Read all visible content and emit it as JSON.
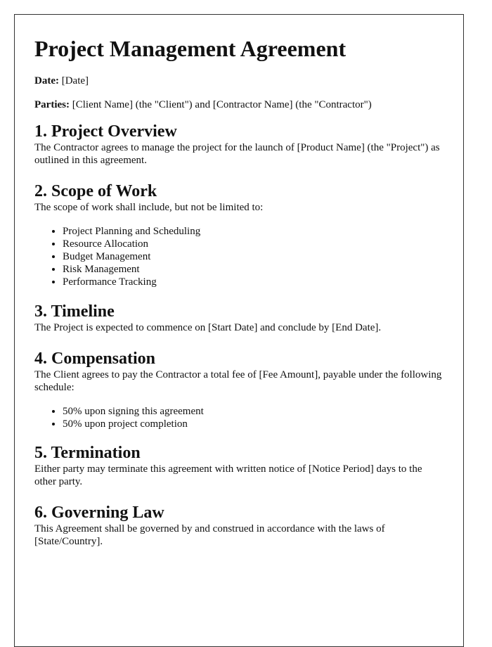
{
  "document": {
    "title": "Project Management Agreement",
    "date": {
      "label": "Date:",
      "value": " [Date]"
    },
    "parties": {
      "label": "Parties:",
      "value": " [Client Name] (the \"Client\") and [Contractor Name] (the \"Contractor\")"
    },
    "sections": [
      {
        "heading": "1. Project Overview",
        "text": "The Contractor agrees to manage the project for the launch of [Product Name] (the \"Project\") as outlined in this agreement."
      },
      {
        "heading": "2. Scope of Work",
        "text": "The scope of work shall include, but not be limited to:",
        "items": [
          "Project Planning and Scheduling",
          "Resource Allocation",
          "Budget Management",
          "Risk Management",
          "Performance Tracking"
        ]
      },
      {
        "heading": "3. Timeline",
        "text": "The Project is expected to commence on [Start Date] and conclude by [End Date]."
      },
      {
        "heading": "4. Compensation",
        "text": "The Client agrees to pay the Contractor a total fee of [Fee Amount], payable under the following schedule:",
        "items": [
          "50% upon signing this agreement",
          "50% upon project completion"
        ]
      },
      {
        "heading": "5. Termination",
        "text": "Either party may terminate this agreement with written notice of [Notice Period] days to the other party."
      },
      {
        "heading": "6. Governing Law",
        "text": "This Agreement shall be governed by and construed in accordance with the laws of [State/Country]."
      }
    ]
  }
}
